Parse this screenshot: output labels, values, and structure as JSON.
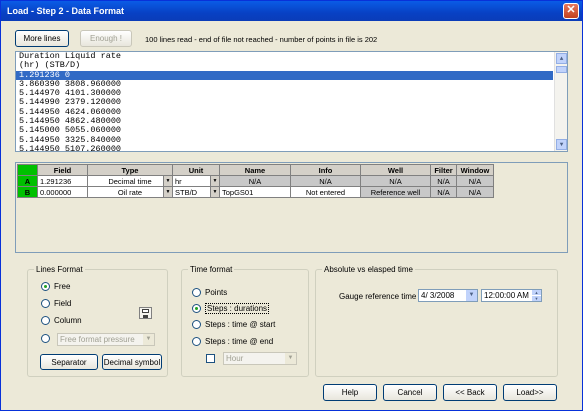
{
  "window": {
    "title": "Load - Step 2 - Data Format"
  },
  "toolbar": {
    "more_lines": "More lines",
    "enough": "Enough !",
    "status": "100 lines read - end of file not reached - number of points in file is 202"
  },
  "preview": {
    "lines": [
      "Duration Liquid rate",
      "(hr) (STB/D)",
      "1.291236 0",
      "3.860390 3808.960000",
      "5.144970 4101.300000",
      "5.144990 2379.120000",
      "5.144950 4624.060000",
      "5.144950 4862.480000",
      "5.145000 5055.060000",
      "5.144950 3325.840000",
      "5.144950 5107.260000"
    ],
    "selected_index": 2
  },
  "grid": {
    "headers": [
      "Field",
      "Type",
      "Unit",
      "Name",
      "Info",
      "Well",
      "Filter",
      "Window"
    ],
    "rows": [
      {
        "id": "A",
        "field": "1.291236",
        "type": "Decimal time",
        "unit": "hr",
        "name": "N/A",
        "info": "N/A",
        "well": "N/A",
        "filter": "N/A",
        "window": "N/A"
      },
      {
        "id": "B",
        "field": "0.000000",
        "type": "Oil rate",
        "unit": "STB/D",
        "name": "TopGS01",
        "info": "Not entered",
        "well": "Reference well",
        "filter": "N/A",
        "window": "N/A"
      }
    ]
  },
  "lines_format": {
    "legend": "Lines Format",
    "options": [
      "Free",
      "Field",
      "Column",
      ""
    ],
    "selected": "Free",
    "combo_value": "Free format pressure",
    "separator": "Separator",
    "decimal_symbol": "Decimal symbol"
  },
  "time_format": {
    "legend": "Time format",
    "options": [
      "Points",
      "Steps : durations",
      "Steps : time @ start",
      "Steps : time @ end"
    ],
    "selected": "Steps : durations",
    "unit_combo": "Hour"
  },
  "abs_elapsed": {
    "legend": "Absolute vs elasped time",
    "label": "Gauge reference time",
    "date": "4/  3/2008",
    "time": "12:00:00 AM"
  },
  "footer": {
    "help": "Help",
    "cancel": "Cancel",
    "back": "<< Back",
    "load": "Load>>"
  },
  "colors": {
    "row_header": "#00c000",
    "title_bar": "#0a5ce6",
    "selection": "#316ac5"
  }
}
